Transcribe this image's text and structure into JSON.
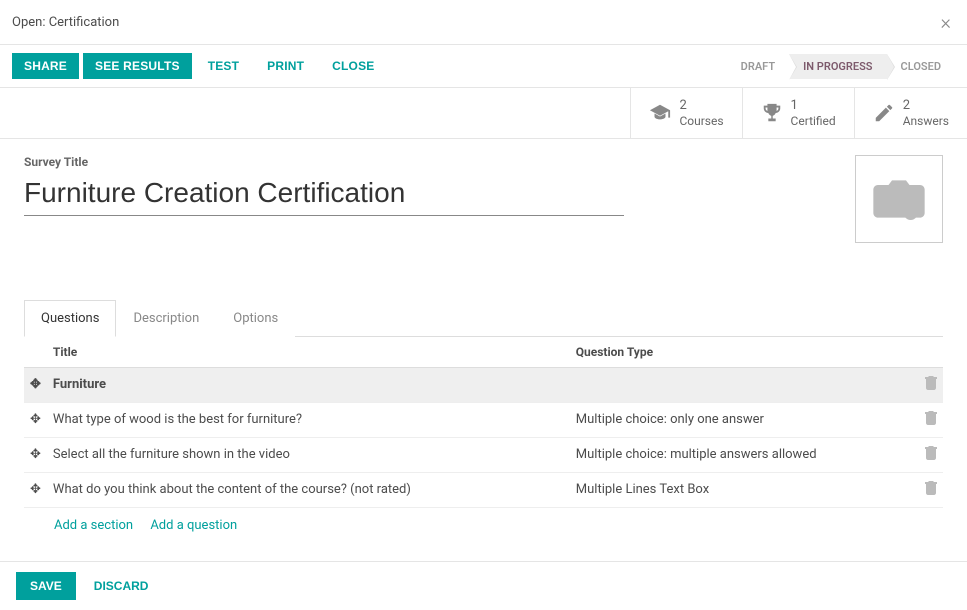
{
  "dialog": {
    "title": "Open: Certification"
  },
  "toolbar": {
    "share": "SHARE",
    "see_results": "SEE RESULTS",
    "test": "TEST",
    "print": "PRINT",
    "close": "CLOSE"
  },
  "status": {
    "draft": "DRAFT",
    "in_progress": "IN PROGRESS",
    "closed": "CLOSED"
  },
  "stats": {
    "courses": {
      "count": "2",
      "label": "Courses"
    },
    "certified": {
      "count": "1",
      "label": "Certified"
    },
    "answers": {
      "count": "2",
      "label": "Answers"
    }
  },
  "form": {
    "survey_title_label": "Survey Title",
    "survey_title_value": "Furniture Creation Certification"
  },
  "tabs": {
    "questions": "Questions",
    "description": "Description",
    "options": "Options"
  },
  "table": {
    "headers": {
      "title": "Title",
      "type": "Question Type"
    },
    "rows": [
      {
        "section": true,
        "title": "Furniture",
        "type": ""
      },
      {
        "section": false,
        "title": "What type of wood is the best for furniture?",
        "type": "Multiple choice: only one answer"
      },
      {
        "section": false,
        "title": "Select all the furniture shown in the video",
        "type": "Multiple choice: multiple answers allowed"
      },
      {
        "section": false,
        "title": "What do you think about the content of the course? (not rated)",
        "type": "Multiple Lines Text Box"
      }
    ],
    "add_section": "Add a section",
    "add_question": "Add a question"
  },
  "footer": {
    "save": "SAVE",
    "discard": "DISCARD"
  }
}
